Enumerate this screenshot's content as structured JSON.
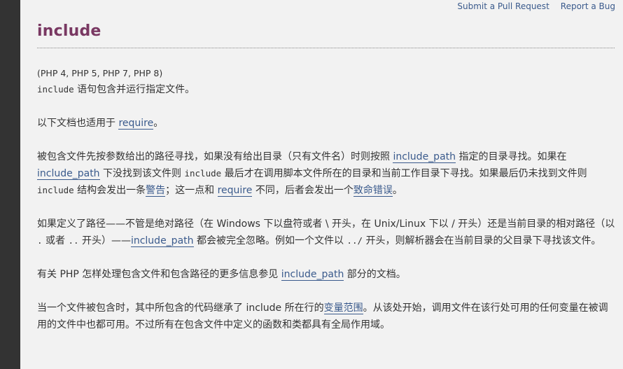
{
  "header": {
    "links": [
      "Submit a Pull Request",
      "Report a Bug"
    ],
    "title": "include"
  },
  "content": {
    "version": "(PHP 4, PHP 5, PHP 7, PHP 8)",
    "p1": {
      "code": "include",
      "text": " 语句包含并运行指定文件。"
    },
    "p2": {
      "pre": "以下文档也适用于 ",
      "link": "require",
      "post": "。"
    },
    "p3": {
      "t1": "被包含文件先按参数给出的路径寻找，如果没有给出目录（只有文件名）时则按照 ",
      "l1": "include_path",
      "t2": " 指定的目录寻找。如果在 ",
      "l2": "include_path",
      "t3": " 下没找到该文件则 ",
      "c1": "include",
      "t4": " 最后才在调用脚本文件所在的目录和当前工作目录下寻找。如果最后仍未找到文件则 ",
      "c2": "include",
      "t5": " 结构会发出一条",
      "l3": "警告",
      "t6": "；这一点和 ",
      "l4": "require",
      "t7": " 不同，后者会发出一个",
      "l5": "致命错误",
      "t8": "。"
    },
    "p4": {
      "t1": "如果定义了路径——不管是绝对路径（在 Windows 下以盘符或者 \\ 开头，在 Unix/Linux 下以 / 开头）还是当前目录的相对路径（以 ",
      "c1": ".",
      "t2": " 或者 ",
      "c2": "..",
      "t3": " 开头）——",
      "l1": "include_path",
      "t4": " 都会被完全忽略。例如一个文件以 ",
      "c3": "../",
      "t5": " 开头，则解析器会在当前目录的父目录下寻找该文件。"
    },
    "p5": {
      "t1": "有关 PHP 怎样处理包含文件和包含路径的更多信息参见 ",
      "l1": "include_path",
      "t2": " 部分的文档。"
    },
    "p6": {
      "t1": "当一个文件被包含时，其中所包含的代码继承了 include 所在行的",
      "l1": "变量范围",
      "t2": "。从该处开始，调用文件在该行处可用的任何变量在被调用的文件中也都可用。不过所有在包含文件中定义的函数和类都具有全局作用域。"
    }
  }
}
